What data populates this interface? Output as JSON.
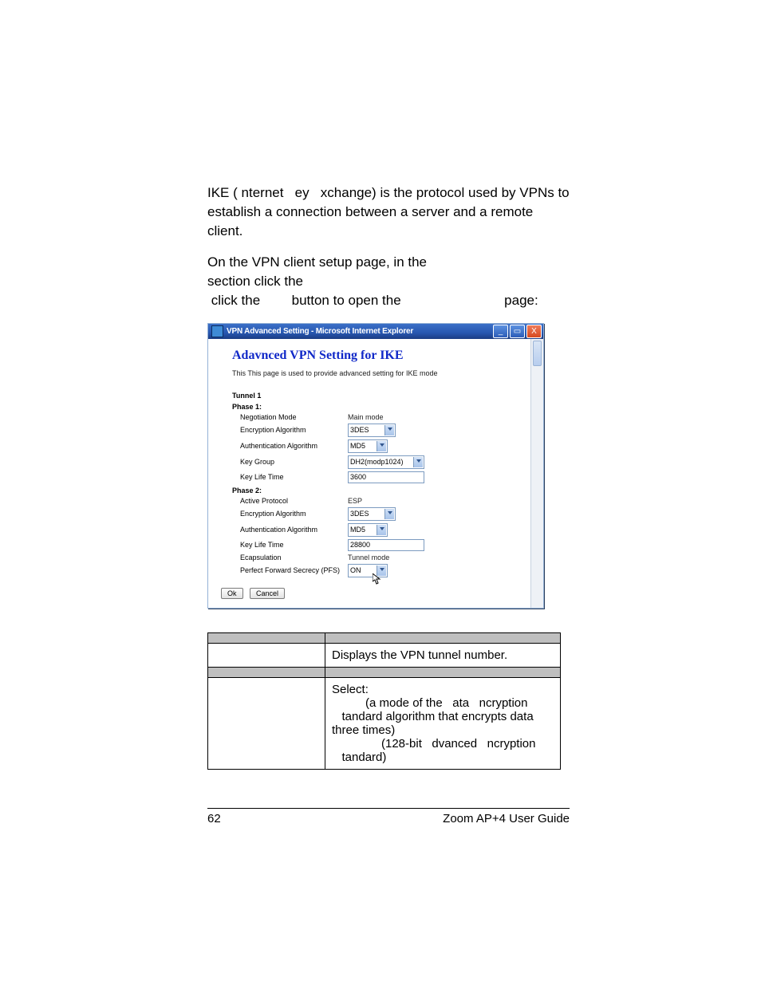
{
  "intro": {
    "p1_a": "IKE (",
    "p1_b": "nternet",
    "p1_c": "ey",
    "p1_d": "xchange) is the protocol used by VPNs to establish a connection between a server and a remote client.",
    "p2_a": "On the VPN client setup page, in the",
    "p2_b": "section click the",
    "p2_c": "button to open the",
    "p2_d": "page:"
  },
  "win": {
    "title": "VPN Advanced Setting - Microsoft Internet Explorer",
    "min": "_",
    "max": "▭",
    "close": "X"
  },
  "ike": {
    "heading": "Adavnced VPN Setting for IKE",
    "sub": "This This page is used to provide advanced setting for IKE mode",
    "tunnel": "Tunnel 1",
    "phase1": "Phase 1:",
    "neg_lbl": "Negotiation Mode",
    "neg_val": "Main mode",
    "enc1_lbl": "Encryption Algorithm",
    "enc1_val": "3DES",
    "auth1_lbl": "Authentication Algorithm",
    "auth1_val": "MD5",
    "kg_lbl": "Key Group",
    "kg_val": "DH2(modp1024)",
    "klt1_lbl": "Key Life Time",
    "klt1_val": "3600",
    "phase2": "Phase 2:",
    "ap_lbl": "Active Protocol",
    "ap_val": "ESP",
    "enc2_lbl": "Encryption Algorithm",
    "enc2_val": "3DES",
    "auth2_lbl": "Authentication Algorithm",
    "auth2_val": "MD5",
    "klt2_lbl": "Key Life Time",
    "klt2_val": "28800",
    "ecap_lbl": "Ecapsulation",
    "ecap_val": "Tunnel mode",
    "pfs_lbl": "Perfect Forward Secrecy (PFS)",
    "pfs_val": "ON",
    "ok": "Ok",
    "cancel": "Cancel"
  },
  "table": {
    "r1c2": "Displays the VPN tunnel number.",
    "sel": "Select:",
    "des_a": "(a mode of the",
    "des_b": "ata",
    "des_c": "ncryption",
    "des_d": "tandard algorithm that encrypts data three times)",
    "aes_a": "(128-bit",
    "aes_b": "dvanced",
    "aes_c": "ncryption",
    "aes_d": "tandard)"
  },
  "footer": {
    "page": "62",
    "guide": "Zoom AP+4 User Guide"
  }
}
